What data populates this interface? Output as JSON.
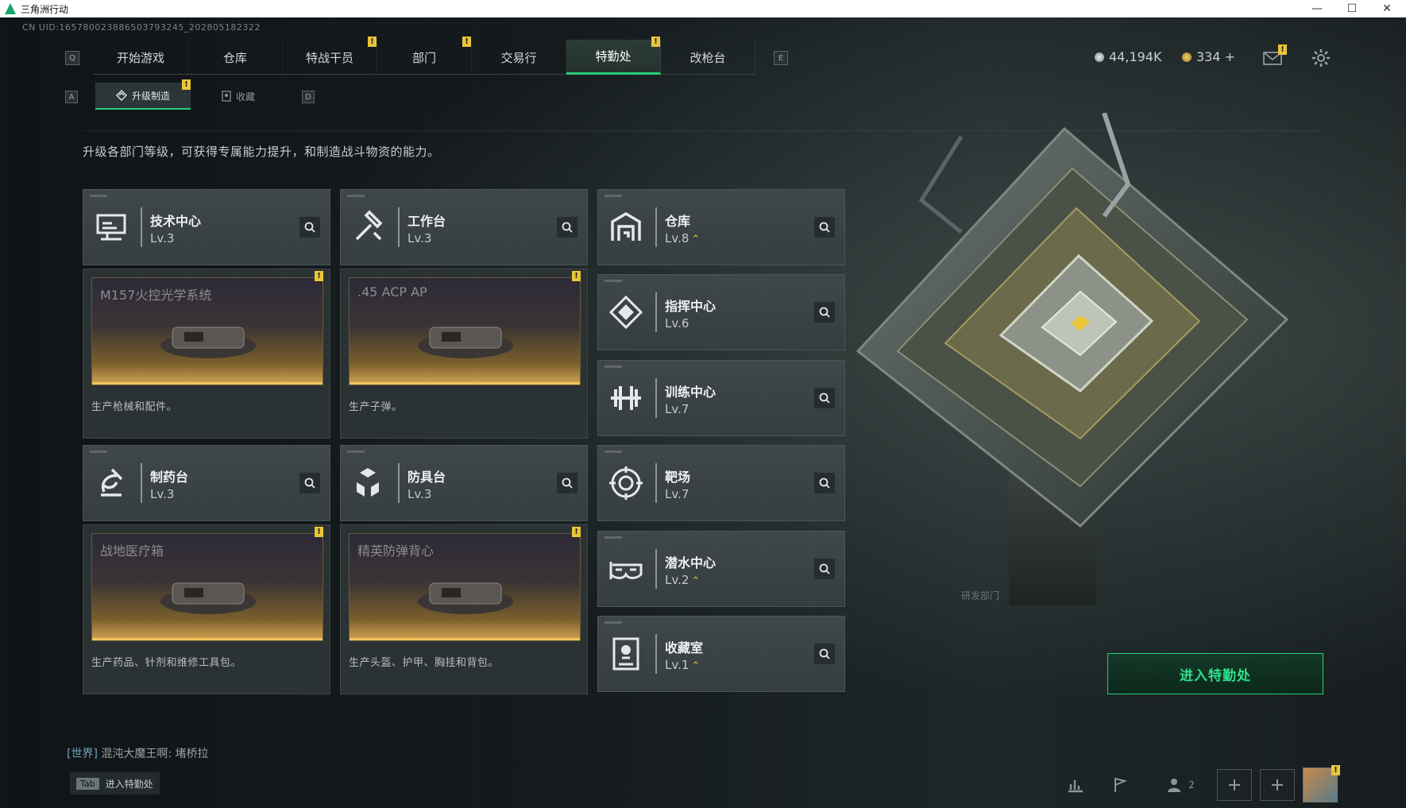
{
  "window": {
    "title": "三角洲行动",
    "minimize": "—",
    "maximize": "☐",
    "close": "✕"
  },
  "uid": "CN UID:1657800238865037932​45_202805182322",
  "nav": {
    "left_key": "Q",
    "right_key": "E",
    "tabs": [
      {
        "label": "开始游戏",
        "badge": false,
        "active": false
      },
      {
        "label": "仓库",
        "badge": false,
        "active": false
      },
      {
        "label": "特战干员",
        "badge": true,
        "active": false
      },
      {
        "label": "部门",
        "badge": true,
        "active": false
      },
      {
        "label": "交易行",
        "badge": false,
        "active": false
      },
      {
        "label": "特勤处",
        "badge": true,
        "active": true
      },
      {
        "label": "改枪台",
        "badge": false,
        "active": false
      }
    ],
    "badge_text": "!"
  },
  "sub_nav": {
    "left_key": "A",
    "right_key": "D",
    "tabs": [
      {
        "label": "升级制造",
        "active": true,
        "badge": true
      },
      {
        "label": "收藏",
        "active": false,
        "badge": false
      }
    ]
  },
  "currency": {
    "coins": "44,194K",
    "tokens": "334 +"
  },
  "description": "升级各部门等级，可获得专属能力提升，和制造战斗物资的能力。",
  "production_cards": [
    {
      "name": "技术中心",
      "level": "Lv.3",
      "product": "M157火控光学系统",
      "desc": "生产枪械和配件。"
    },
    {
      "name": "工作台",
      "level": "Lv.3",
      "product": ".45 ACP AP",
      "desc": "生产子弹。"
    },
    {
      "name": "制药台",
      "level": "Lv.3",
      "product": "战地医疗箱",
      "desc": "生产药品、针剂和维修工具包。"
    },
    {
      "name": "防具台",
      "level": "Lv.3",
      "product": "精英防弹背心",
      "desc": "生产头盔、护甲、胸挂和背包。"
    }
  ],
  "facility_cards": [
    {
      "name": "仓库",
      "level": "Lv.8",
      "upgradable": true
    },
    {
      "name": "指挥中心",
      "level": "Lv.6",
      "upgradable": false
    },
    {
      "name": "训练中心",
      "level": "Lv.7",
      "upgradable": false
    },
    {
      "name": "靶场",
      "level": "Lv.7",
      "upgradable": false
    },
    {
      "name": "潜水中心",
      "level": "Lv.2",
      "upgradable": true
    },
    {
      "name": "收藏室",
      "level": "Lv.1",
      "upgradable": true
    }
  ],
  "enter_button": "进入特勤处",
  "structure_label": "研发部门",
  "chat": {
    "channel": "[世界]",
    "message": "混沌大魔王啊: 堵桥拉"
  },
  "tab_hint": {
    "key": "Tab",
    "label": "进入特勤处"
  },
  "bottom_bar": {
    "squad_count": "2"
  },
  "colors": {
    "accent": "#24d07a",
    "badge": "#e9c53a",
    "card": "#3a4244"
  }
}
